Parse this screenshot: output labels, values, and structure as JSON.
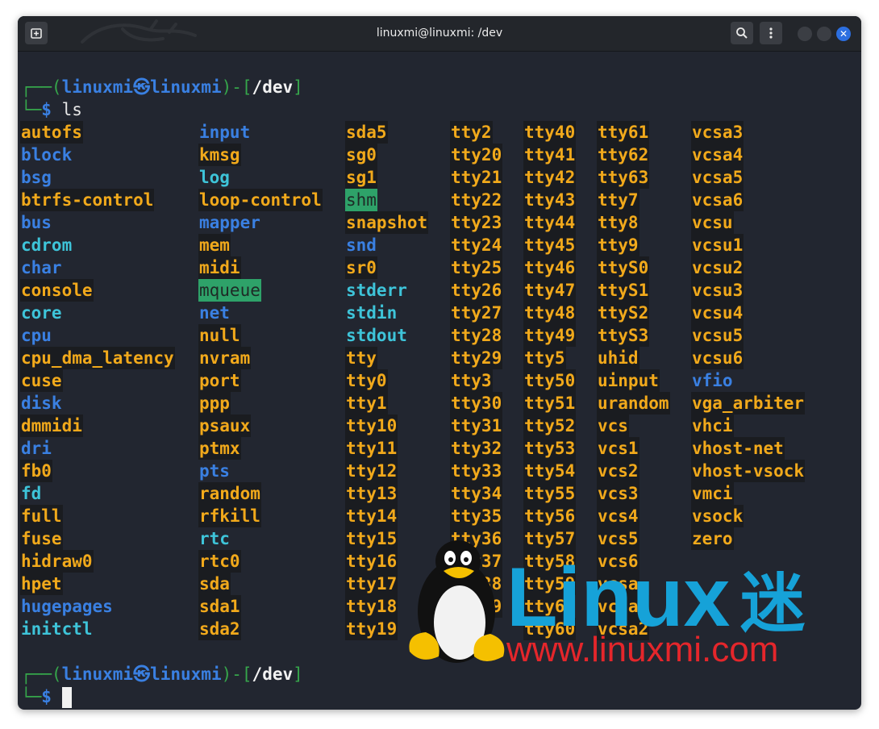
{
  "window": {
    "title": "linuxmi@linuxmi: /dev",
    "buttons": {
      "new_tab_icon": "new-tab-icon",
      "search_icon": "search-icon",
      "menu_icon": "kebab-menu-icon"
    }
  },
  "prompt1": {
    "open": "┌──(",
    "user": "linuxmi",
    "at": "㉿",
    "host": "linuxmi",
    "mid": ")-[",
    "path": "/dev",
    "close": "]",
    "dollar_prefix": "└─",
    "dollar": "$",
    "command": "ls"
  },
  "prompt2": {
    "open": "┌──(",
    "user": "linuxmi",
    "at": "㉿",
    "host": "linuxmi",
    "mid": ")-[",
    "path": "/dev",
    "close": "]",
    "dollar_prefix": "└─",
    "dollar": "$",
    "command": ""
  },
  "ls_columns": [
    [
      [
        "autofs",
        "dev"
      ],
      [
        "block",
        "dir"
      ],
      [
        "bsg",
        "dir"
      ],
      [
        "btrfs-control",
        "dev"
      ],
      [
        "bus",
        "dir"
      ],
      [
        "cdrom",
        "lnk"
      ],
      [
        "char",
        "dir"
      ],
      [
        "console",
        "dev"
      ],
      [
        "core",
        "lnk"
      ],
      [
        "cpu",
        "dir"
      ],
      [
        "cpu_dma_latency",
        "dev"
      ],
      [
        "cuse",
        "dev"
      ],
      [
        "disk",
        "dir"
      ],
      [
        "dmmidi",
        "dev"
      ],
      [
        "dri",
        "dir"
      ],
      [
        "fb0",
        "dev"
      ],
      [
        "fd",
        "lnk"
      ],
      [
        "full",
        "dev"
      ],
      [
        "fuse",
        "dev"
      ],
      [
        "hidraw0",
        "dev"
      ],
      [
        "hpet",
        "dev"
      ],
      [
        "hugepages",
        "dir"
      ],
      [
        "initctl",
        "lnk"
      ]
    ],
    [
      [
        "input",
        "dir"
      ],
      [
        "kmsg",
        "dev"
      ],
      [
        "log",
        "lnk"
      ],
      [
        "loop-control",
        "dev"
      ],
      [
        "mapper",
        "dir"
      ],
      [
        "mem",
        "dev"
      ],
      [
        "midi",
        "dev"
      ],
      [
        "mqueue",
        "sticky"
      ],
      [
        "net",
        "dir"
      ],
      [
        "null",
        "dev"
      ],
      [
        "nvram",
        "dev"
      ],
      [
        "port",
        "dev"
      ],
      [
        "ppp",
        "dev"
      ],
      [
        "psaux",
        "dev"
      ],
      [
        "ptmx",
        "dev"
      ],
      [
        "pts",
        "dir"
      ],
      [
        "random",
        "dev"
      ],
      [
        "rfkill",
        "dev"
      ],
      [
        "rtc",
        "lnk"
      ],
      [
        "rtc0",
        "dev"
      ],
      [
        "sda",
        "dev"
      ],
      [
        "sda1",
        "dev"
      ],
      [
        "sda2",
        "dev"
      ]
    ],
    [
      [
        "sda5",
        "dev"
      ],
      [
        "sg0",
        "dev"
      ],
      [
        "sg1",
        "dev"
      ],
      [
        "shm",
        "sticky"
      ],
      [
        "snapshot",
        "dev"
      ],
      [
        "snd",
        "dir"
      ],
      [
        "sr0",
        "dev"
      ],
      [
        "stderr",
        "lnk"
      ],
      [
        "stdin",
        "lnk"
      ],
      [
        "stdout",
        "lnk"
      ],
      [
        "tty",
        "dev"
      ],
      [
        "tty0",
        "dev"
      ],
      [
        "tty1",
        "dev"
      ],
      [
        "tty10",
        "dev"
      ],
      [
        "tty11",
        "dev"
      ],
      [
        "tty12",
        "dev"
      ],
      [
        "tty13",
        "dev"
      ],
      [
        "tty14",
        "dev"
      ],
      [
        "tty15",
        "dev"
      ],
      [
        "tty16",
        "dev"
      ],
      [
        "tty17",
        "dev"
      ],
      [
        "tty18",
        "dev"
      ],
      [
        "tty19",
        "dev"
      ]
    ],
    [
      [
        "tty2",
        "dev"
      ],
      [
        "tty20",
        "dev"
      ],
      [
        "tty21",
        "dev"
      ],
      [
        "tty22",
        "dev"
      ],
      [
        "tty23",
        "dev"
      ],
      [
        "tty24",
        "dev"
      ],
      [
        "tty25",
        "dev"
      ],
      [
        "tty26",
        "dev"
      ],
      [
        "tty27",
        "dev"
      ],
      [
        "tty28",
        "dev"
      ],
      [
        "tty29",
        "dev"
      ],
      [
        "tty3",
        "dev"
      ],
      [
        "tty30",
        "dev"
      ],
      [
        "tty31",
        "dev"
      ],
      [
        "tty32",
        "dev"
      ],
      [
        "tty33",
        "dev"
      ],
      [
        "tty34",
        "dev"
      ],
      [
        "tty35",
        "dev"
      ],
      [
        "tty36",
        "dev"
      ],
      [
        "tty37",
        "dev"
      ],
      [
        "tty38",
        "dev"
      ],
      [
        "tty39",
        "dev"
      ]
    ],
    [
      [
        "tty40",
        "dev"
      ],
      [
        "tty41",
        "dev"
      ],
      [
        "tty42",
        "dev"
      ],
      [
        "tty43",
        "dev"
      ],
      [
        "tty44",
        "dev"
      ],
      [
        "tty45",
        "dev"
      ],
      [
        "tty46",
        "dev"
      ],
      [
        "tty47",
        "dev"
      ],
      [
        "tty48",
        "dev"
      ],
      [
        "tty49",
        "dev"
      ],
      [
        "tty5",
        "dev"
      ],
      [
        "tty50",
        "dev"
      ],
      [
        "tty51",
        "dev"
      ],
      [
        "tty52",
        "dev"
      ],
      [
        "tty53",
        "dev"
      ],
      [
        "tty54",
        "dev"
      ],
      [
        "tty55",
        "dev"
      ],
      [
        "tty56",
        "dev"
      ],
      [
        "tty57",
        "dev"
      ],
      [
        "tty58",
        "dev"
      ],
      [
        "tty59",
        "dev"
      ],
      [
        "tty6",
        "dev"
      ],
      [
        "tty60",
        "dev"
      ]
    ],
    [
      [
        "tty61",
        "dev"
      ],
      [
        "tty62",
        "dev"
      ],
      [
        "tty63",
        "dev"
      ],
      [
        "tty7",
        "dev"
      ],
      [
        "tty8",
        "dev"
      ],
      [
        "tty9",
        "dev"
      ],
      [
        "ttyS0",
        "dev"
      ],
      [
        "ttyS1",
        "dev"
      ],
      [
        "ttyS2",
        "dev"
      ],
      [
        "ttyS3",
        "dev"
      ],
      [
        "uhid",
        "dev"
      ],
      [
        "uinput",
        "dev"
      ],
      [
        "urandom",
        "dev"
      ],
      [
        "vcs",
        "dev"
      ],
      [
        "vcs1",
        "dev"
      ],
      [
        "vcs2",
        "dev"
      ],
      [
        "vcs3",
        "dev"
      ],
      [
        "vcs4",
        "dev"
      ],
      [
        "vcs5",
        "dev"
      ],
      [
        "vcs6",
        "dev"
      ],
      [
        "vcsa",
        "dev"
      ],
      [
        "vcsa1",
        "dev"
      ],
      [
        "vcsa2",
        "dev"
      ]
    ],
    [
      [
        "vcsa3",
        "dev"
      ],
      [
        "vcsa4",
        "dev"
      ],
      [
        "vcsa5",
        "dev"
      ],
      [
        "vcsa6",
        "dev"
      ],
      [
        "vcsu",
        "dev"
      ],
      [
        "vcsu1",
        "dev"
      ],
      [
        "vcsu2",
        "dev"
      ],
      [
        "vcsu3",
        "dev"
      ],
      [
        "vcsu4",
        "dev"
      ],
      [
        "vcsu5",
        "dev"
      ],
      [
        "vcsu6",
        "dev"
      ],
      [
        "vfio",
        "dir"
      ],
      [
        "vga_arbiter",
        "dev"
      ],
      [
        "vhci",
        "dev"
      ],
      [
        "vhost-net",
        "dev"
      ],
      [
        "vhost-vsock",
        "dev"
      ],
      [
        "vmci",
        "dev"
      ],
      [
        "vsock",
        "dev"
      ],
      [
        "zero",
        "dev"
      ]
    ]
  ],
  "watermark": {
    "brand": "Linux",
    "brand_cn": "迷",
    "url": "www.linuxmi.com"
  },
  "colors": {
    "dir": "#3a80e2",
    "dev": "#f1a91b",
    "lnk": "#3ec4d9",
    "sticky_bg": "#2ea269",
    "prompt": "#36a64b",
    "bg": "#222630",
    "close": "#2c6fe0"
  }
}
